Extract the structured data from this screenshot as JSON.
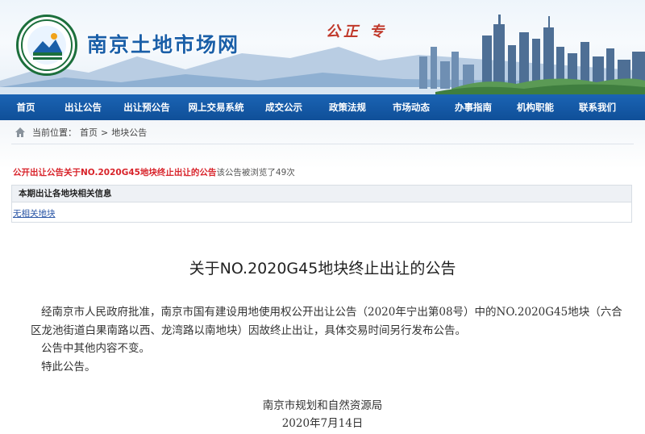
{
  "header": {
    "site_title": "南京土地市场网",
    "slogan": "公正 专"
  },
  "nav": {
    "items": [
      {
        "label": "首页"
      },
      {
        "label": "出让公告"
      },
      {
        "label": "出让预公告"
      },
      {
        "label": "网上交易系统"
      },
      {
        "label": "成交公示"
      },
      {
        "label": "政策法规"
      },
      {
        "label": "市场动态"
      },
      {
        "label": "办事指南"
      },
      {
        "label": "机构职能"
      },
      {
        "label": "联系我们"
      }
    ]
  },
  "breadcrumb": {
    "prefix": "当前位置：",
    "home": "首页",
    "sep": ">",
    "current": "地块公告"
  },
  "notice": {
    "category": "公开出让公告",
    "title": "关于NO.2020G45地块终止出让的公告",
    "views_text": "该公告被浏览了49次"
  },
  "info_box": {
    "header": "本期出让各地块相关信息",
    "link": "无相关地块"
  },
  "article": {
    "title": "关于NO.2020G45地块终止出让的公告",
    "para1": "经南京市人民政府批准，南京市国有建设用地使用权公开出让公告（2020年宁出第08号）中的NO.2020G45地块（六合区龙池街道白果南路以西、龙湾路以南地块）因故终止出让，具体交易时间另行发布公告。",
    "para2": "公告中其他内容不变。",
    "para3": "特此公告。",
    "signer": "南京市规划和自然资源局",
    "date": "2020年7月14日"
  },
  "colors": {
    "nav_bg": "#1b64b4",
    "title_blue": "#1a5fa8",
    "notice_red": "#d8232a",
    "link_blue": "#2a56a6"
  }
}
